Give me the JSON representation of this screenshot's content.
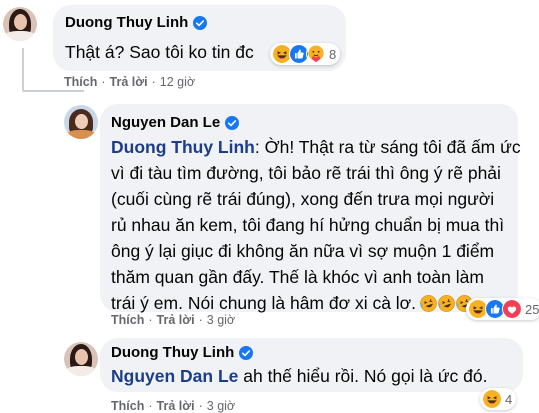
{
  "colors": {
    "bubble": "#f0f2f5",
    "verified": "#1877f2",
    "meta_text": "#65676b",
    "tag": "#1c3d8a"
  },
  "comments": [
    {
      "author": "Duong Thuy Linh",
      "verified_icon": "verified-badge-icon",
      "text": "Thật á? Sao tôi ko tin đc",
      "reactions": {
        "icons": [
          "haha-emoji-icon",
          "like-icon",
          "care-emoji-icon"
        ],
        "count": "8"
      },
      "actions": {
        "like": "Thích",
        "reply": "Trả lời",
        "time": "12 giờ"
      }
    },
    {
      "author": "Nguyen Dan Le",
      "verified_icon": "verified-badge-icon",
      "mention": "Duong Thuy Linh",
      "text_lines": [
        ": Ờh! Thật ra từ sáng tôi đã ấm ức",
        "vì đi tàu tìm đường, tôi bảo rẽ trái thì ông ý rẽ phải",
        "(cuối cùng rẽ trái đúng), xong đến trưa mọi người",
        "rủ nhau ăn kem, tôi đang hí hửng chuẩn bị mua thì",
        "ông ý lại giục đi không ăn nữa vì sợ muộn 1 điểm",
        "thăm quan gần đấy. Thế là khóc vì anh toàn làm",
        "trái ý em. Nói chung là hâm đơ xi cà lơ."
      ],
      "inline_emojis": [
        "rofl-emoji-icon",
        "rofl-emoji-icon",
        "rofl-emoji-icon"
      ],
      "reactions": {
        "icons": [
          "haha-emoji-icon",
          "like-icon",
          "love-icon"
        ],
        "count": "25"
      },
      "actions": {
        "like": "Thích",
        "reply": "Trả lời",
        "time": "3 giờ"
      }
    },
    {
      "author": "Duong Thuy Linh",
      "verified_icon": "verified-badge-icon",
      "mention": "Nguyen Dan Le",
      "text": " ah thế hiểu rồi. Nó gọi là ức đó.",
      "reactions": {
        "icons": [
          "haha-emoji-icon"
        ],
        "count": "4"
      },
      "actions": {
        "like": "Thích",
        "reply": "Trả lời",
        "time": "3 giờ"
      }
    }
  ]
}
